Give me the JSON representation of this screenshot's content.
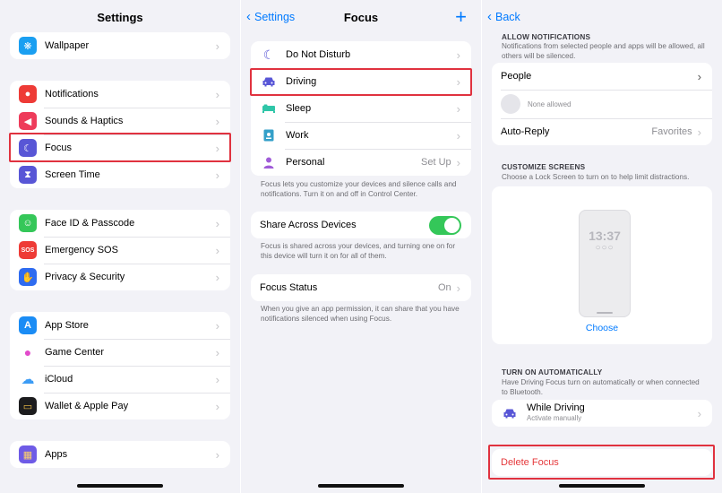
{
  "settings": {
    "title": "Settings",
    "groups": [
      {
        "items": [
          {
            "label": "Wallpaper",
            "icon": "wallpaper-icon",
            "color": "#1a9ff1",
            "glyph": "❋"
          }
        ]
      },
      {
        "items": [
          {
            "label": "Notifications",
            "icon": "notifications-icon",
            "color": "#ee3b36",
            "glyph": "●"
          },
          {
            "label": "Sounds & Haptics",
            "icon": "speaker-icon",
            "color": "#ee3b5a",
            "glyph": "◀"
          },
          {
            "label": "Focus",
            "icon": "moon-icon",
            "color": "#5856d6",
            "glyph": "☾"
          },
          {
            "label": "Screen Time",
            "icon": "hourglass-icon",
            "color": "#5856d6",
            "glyph": "⧗"
          }
        ]
      },
      {
        "items": [
          {
            "label": "Face ID & Passcode",
            "icon": "face-id-icon",
            "color": "#35c759",
            "glyph": "☺"
          },
          {
            "label": "Emergency SOS",
            "icon": "sos-icon",
            "color": "#ee3b36",
            "glyph": "SOS"
          },
          {
            "label": "Privacy & Security",
            "icon": "hand-icon",
            "color": "#2e6bf0",
            "glyph": "✋"
          }
        ]
      },
      {
        "items": [
          {
            "label": "App Store",
            "icon": "app-store-icon",
            "color": "#1a8cf5",
            "glyph": "A"
          },
          {
            "label": "Game Center",
            "icon": "game-center-icon",
            "color": "#ffffff",
            "glyph": "●"
          },
          {
            "label": "iCloud",
            "icon": "cloud-icon",
            "color": "#ffffff",
            "glyph": "☁"
          },
          {
            "label": "Wallet & Apple Pay",
            "icon": "wallet-icon",
            "color": "#1c1c1e",
            "glyph": "▭"
          }
        ]
      },
      {
        "items": [
          {
            "label": "Apps",
            "icon": "apps-grid-icon",
            "color": "#6e5be6",
            "glyph": "▦"
          }
        ]
      }
    ]
  },
  "focus": {
    "back_label": "Settings",
    "title": "Focus",
    "add_glyph": "+",
    "modes": [
      {
        "label": "Do Not Disturb",
        "icon": "moon-icon",
        "color": "#5856d6",
        "glyph": "☾",
        "value": ""
      },
      {
        "label": "Driving",
        "icon": "car-icon",
        "color": "#5856d6",
        "glyph": "🚘",
        "value": ""
      },
      {
        "label": "Sleep",
        "icon": "bed-icon",
        "color": "#2fc6a8",
        "glyph": "▬",
        "value": ""
      },
      {
        "label": "Work",
        "icon": "id-badge-icon",
        "color": "#34a0c9",
        "glyph": "▣",
        "value": ""
      },
      {
        "label": "Personal",
        "icon": "person-icon",
        "color": "#a05cd8",
        "glyph": "●",
        "value": "Set Up"
      }
    ],
    "modes_footer": "Focus lets you customize your devices and silence calls and notifications. Turn it on and off in Control Center.",
    "share_label": "Share Across Devices",
    "share_footer": "Focus is shared across your devices, and turning one on for this device will turn it on for all of them.",
    "status_label": "Focus Status",
    "status_value": "On",
    "status_footer": "When you give an app permission, it can share that you have notifications silenced when using Focus."
  },
  "driving": {
    "back_label": "Back",
    "allow_header": "ALLOW NOTIFICATIONS",
    "allow_sub": "Notifications from selected people and apps will be allowed, all others will be silenced.",
    "people_label": "People",
    "none_allowed": "None allowed",
    "auto_reply_label": "Auto-Reply",
    "auto_reply_value": "Favorites",
    "customize_header": "CUSTOMIZE SCREENS",
    "customize_sub": "Choose a Lock Screen to turn on to help limit distractions.",
    "lock_time": "13:37",
    "lock_dots": "○○○",
    "choose_label": "Choose",
    "auto_header": "TURN ON AUTOMATICALLY",
    "auto_sub": "Have Driving Focus turn on automatically or when connected to Bluetooth.",
    "while_driving_label": "While Driving",
    "while_driving_sub": "Activate manually",
    "delete_label": "Delete Focus"
  },
  "colors": {
    "accent": "#007aff",
    "highlight": "#e0323f",
    "toggle_on": "#34c759",
    "destructive": "#e5383b"
  }
}
